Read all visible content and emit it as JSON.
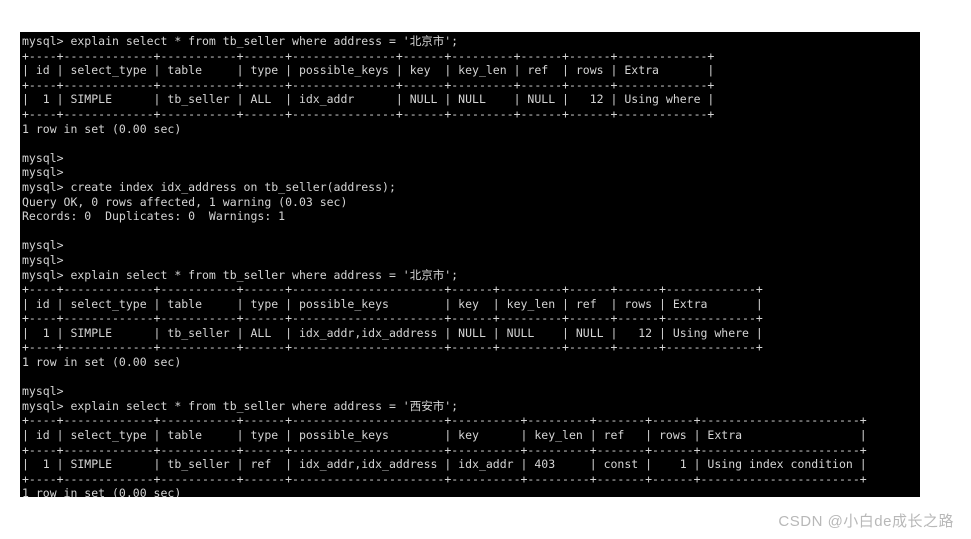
{
  "window": {
    "kind": "mysql-cli-terminal",
    "background": "#000000",
    "foreground": "#d4d4d4",
    "page_background": "#ffffff"
  },
  "watermark": {
    "text": "CSDN @小白de成长之路",
    "color": "#b8b8b8"
  },
  "session": {
    "prompt": "mysql>",
    "queries": [
      "explain select * from tb_seller where address = '北京市';",
      "create index idx_address on tb_seller(address);",
      "explain select * from tb_seller where address = '北京市';",
      "explain select * from tb_seller where address = '西安市';"
    ],
    "status_messages": [
      "1 row in set (0.00 sec)",
      "Query OK, 0 rows affected, 1 warning (0.03 sec)",
      "Records: 0  Duplicates: 0  Warnings: 1",
      "1 row in set (0.00 sec)",
      "1 row in set (0.00 sec)"
    ],
    "explain_columns": [
      "id",
      "select_type",
      "table",
      "type",
      "possible_keys",
      "key",
      "key_len",
      "ref",
      "rows",
      "Extra"
    ],
    "explain_results": [
      {
        "id": "1",
        "select_type": "SIMPLE",
        "table": "tb_seller",
        "type": "ALL",
        "possible_keys": "idx_addr",
        "key": "NULL",
        "key_len": "NULL",
        "ref": "NULL",
        "rows": "12",
        "Extra": "Using where"
      },
      {
        "id": "1",
        "select_type": "SIMPLE",
        "table": "tb_seller",
        "type": "ALL",
        "possible_keys": "idx_addr,idx_address",
        "key": "NULL",
        "key_len": "NULL",
        "ref": "NULL",
        "rows": "12",
        "Extra": "Using where"
      },
      {
        "id": "1",
        "select_type": "SIMPLE",
        "table": "tb_seller",
        "type": "ref",
        "possible_keys": "idx_addr,idx_address",
        "key": "idx_addr",
        "key_len": "403",
        "ref": "const",
        "rows": "1",
        "Extra": "Using index condition"
      }
    ]
  },
  "lines": [
    "mysql> explain select * from tb_seller where address = '北京市';",
    "+----+-------------+-----------+------+---------------+------+---------+------+------+-------------+",
    "| id | select_type | table     | type | possible_keys | key  | key_len | ref  | rows | Extra       |",
    "+----+-------------+-----------+------+---------------+------+---------+------+------+-------------+",
    "|  1 | SIMPLE      | tb_seller | ALL  | idx_addr      | NULL | NULL    | NULL |   12 | Using where |",
    "+----+-------------+-----------+------+---------------+------+---------+------+------+-------------+",
    "1 row in set (0.00 sec)",
    "",
    "mysql>",
    "mysql>",
    "mysql> create index idx_address on tb_seller(address);",
    "Query OK, 0 rows affected, 1 warning (0.03 sec)",
    "Records: 0  Duplicates: 0  Warnings: 1",
    "",
    "mysql>",
    "mysql>",
    "mysql> explain select * from tb_seller where address = '北京市';",
    "+----+-------------+-----------+------+----------------------+------+---------+------+------+-------------+",
    "| id | select_type | table     | type | possible_keys        | key  | key_len | ref  | rows | Extra       |",
    "+----+-------------+-----------+------+----------------------+------+---------+------+------+-------------+",
    "|  1 | SIMPLE      | tb_seller | ALL  | idx_addr,idx_address | NULL | NULL    | NULL |   12 | Using where |",
    "+----+-------------+-----------+------+----------------------+------+---------+------+------+-------------+",
    "1 row in set (0.00 sec)",
    "",
    "mysql>",
    "mysql> explain select * from tb_seller where address = '西安市';",
    "+----+-------------+-----------+------+----------------------+----------+---------+-------+------+-----------------------+",
    "| id | select_type | table     | type | possible_keys        | key      | key_len | ref   | rows | Extra                 |",
    "+----+-------------+-----------+------+----------------------+----------+---------+-------+------+-----------------------+",
    "|  1 | SIMPLE      | tb_seller | ref  | idx_addr,idx_address | idx_addr | 403     | const |    1 | Using index condition |",
    "+----+-------------+-----------+------+----------------------+----------+---------+-------+------+-----------------------+",
    "1 row in set (0.00 sec)"
  ]
}
